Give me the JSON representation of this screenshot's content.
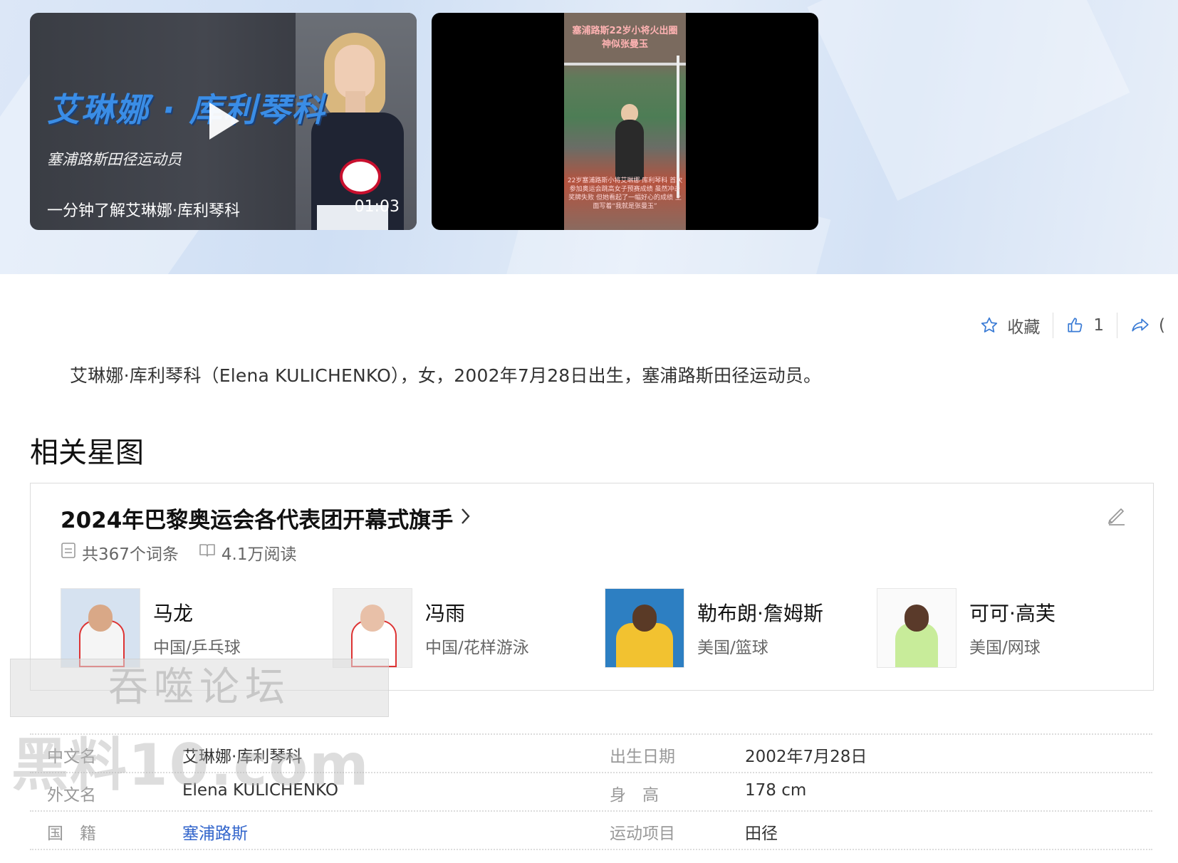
{
  "videos": [
    {
      "title": "艾琳娜 · 库利琴科",
      "subtitle": "塞浦路斯田径运动员",
      "caption": "一分钟了解艾琳娜·库利琴科",
      "duration": "01:03"
    },
    {
      "top_text": "塞浦路斯22岁小将火出圈 神似张曼玉",
      "bottom_text": "22岁塞浦路斯小将艾琳娜·库利琴科 首次参加奥运会跳高女子预赛成绩 虽然冲击奖牌失败 但她看起了一幅好心的成绩 上面写着“我就是张曼玉”"
    }
  ],
  "actions": {
    "favorite_label": "收藏",
    "like_count": "1",
    "share_partial": "("
  },
  "summary": "艾琳娜·库利琴科（Elena KULICHENKO），女，2002年7月28日出生，塞浦路斯田径运动员。",
  "related": {
    "section_title": "相关星图",
    "card_title": "2024年巴黎奥运会各代表团开幕式旗手",
    "entries": "共367个词条",
    "reads": "4.1万阅读",
    "people": [
      {
        "name": "马龙",
        "desc": "中国/乒乓球"
      },
      {
        "name": "冯雨",
        "desc": "中国/花样游泳"
      },
      {
        "name": "勒布朗·詹姆斯",
        "desc": "美国/篮球"
      },
      {
        "name": "可可·高芙",
        "desc": "美国/网球"
      }
    ]
  },
  "watermarks": {
    "line1": "吞噬论坛",
    "line2": "黑料10.com"
  },
  "info": {
    "rows": [
      {
        "l1": "中文名",
        "v1": "艾琳娜·库利琴科",
        "l2": "出生日期",
        "v2": "2002年7月28日"
      },
      {
        "l1": "外文名",
        "v1": "Elena KULICHENKO",
        "l2": "身　高",
        "v2": "178 cm"
      },
      {
        "l1": "国　籍",
        "v1": "塞浦路斯",
        "l2": "运动项目",
        "v2": "田径"
      }
    ]
  },
  "colors": {
    "accent": "#3366cc",
    "banner": "#dce7f7"
  }
}
